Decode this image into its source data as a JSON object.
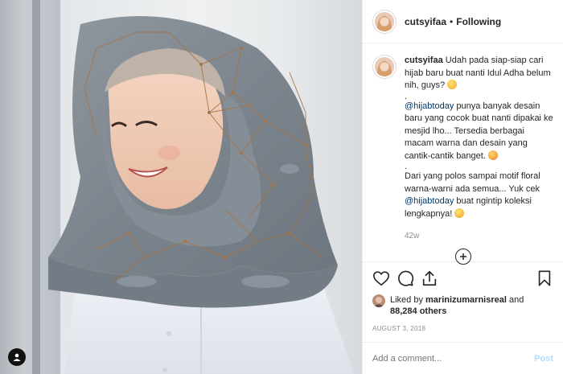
{
  "header": {
    "username": "cutsyifaa",
    "separator": "•",
    "follow_status": "Following"
  },
  "caption": {
    "username": "cutsyifaa",
    "line1": "Udah pada siap-siap cari hijab baru buat nanti Idul Adha belum nih, guys?",
    "dot1": ".",
    "mention1": "@hijabtoday",
    "line2": " punya banyak desain baru yang cocok buat nanti dipakai ke mesjid lho... Tersedia berbagai macam warna dan desain yang cantik-cantik banget.",
    "dot2": ".",
    "line3a": "Dari yang polos sampai motif floral warna-warni ada semua... Yuk cek ",
    "mention2": "@hijabtoday",
    "line3b": " buat ngintip koleksi lengkapnya!",
    "time_ago": "42w"
  },
  "likes": {
    "prefix": "Liked by ",
    "liker": "marinizumarnisreal",
    "and": " and",
    "others": "88,284 others"
  },
  "date": "AUGUST 3, 2018",
  "comment_box": {
    "placeholder": "Add a comment...",
    "post_label": "Post"
  },
  "icons": {
    "like": "heart-icon",
    "comment": "comment-icon",
    "share": "share-icon",
    "save": "bookmark-icon",
    "load_more": "plus-circle-icon",
    "user_tag": "person-icon"
  },
  "colors": {
    "mention": "#00376b",
    "post_button_disabled": "#b3dbff",
    "muted_text": "#8e8e8e",
    "hijab": "#7f8791"
  }
}
